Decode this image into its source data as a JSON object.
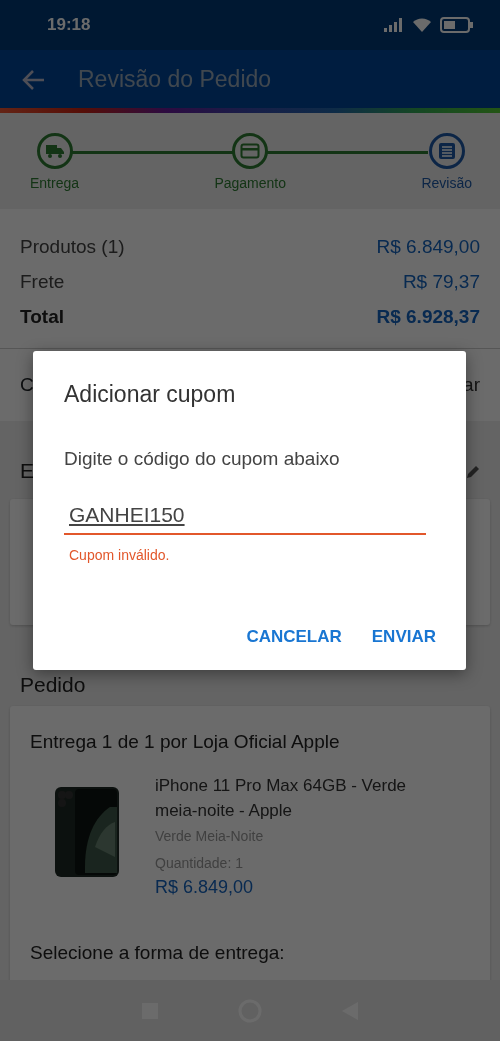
{
  "status_bar": {
    "time": "19:18"
  },
  "app_bar": {
    "title": "Revisão do Pedido"
  },
  "steps": [
    {
      "label": "Entrega",
      "selected": false
    },
    {
      "label": "Pagamento",
      "selected": false
    },
    {
      "label": "Revisão",
      "selected": true
    }
  ],
  "summary": [
    {
      "label": "Produtos (1)",
      "value": "R$ 6.849,00",
      "kind": "line"
    },
    {
      "label": "Frete",
      "value": "R$ 79,37",
      "kind": "line"
    },
    {
      "label": "Total",
      "value": "R$ 6.928,37",
      "kind": "total"
    }
  ],
  "coupon_row": {
    "label": "C",
    "action": "ar"
  },
  "address_section": {
    "title": "E"
  },
  "order_section": {
    "title": "Pedido",
    "group_title": "Entrega 1 de 1 por Loja Oficial Apple",
    "product": {
      "name": "iPhone 11 Pro Max 64GB - Verde meia-noite - Apple",
      "variant": "Verde Meia-Noite",
      "quantity_label": "Quantidade:",
      "quantity": "1",
      "price": "R$ 6.849,00"
    },
    "shipping_prompt": "Selecione a forma de entrega:"
  },
  "dialog": {
    "title": "Adicionar cupom",
    "message": "Digite o código do cupom abaixo",
    "value": "GANHEI150",
    "error": "Cupom inválido.",
    "buttons": [
      "CANCELAR",
      "ENVIAR"
    ]
  }
}
